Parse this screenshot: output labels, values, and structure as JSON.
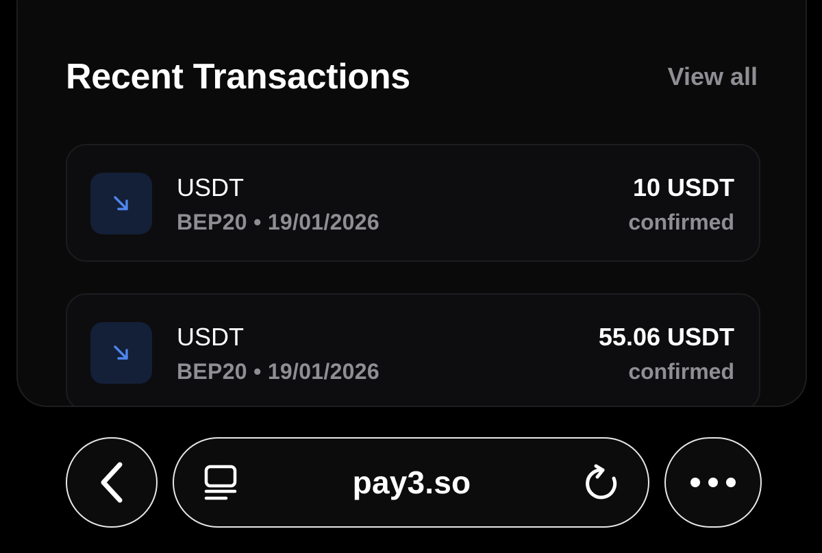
{
  "card": {
    "title": "Recent Transactions",
    "view_all": "View all"
  },
  "transactions": [
    {
      "token": "USDT",
      "network": "BEP20",
      "separator": "•",
      "date": "19/01/2026",
      "amount": "10 USDT",
      "status": "confirmed",
      "icon": "arrow-down-right-icon"
    },
    {
      "token": "USDT",
      "network": "BEP20",
      "separator": "•",
      "date": "19/01/2026",
      "amount": "55.06 USDT",
      "status": "confirmed",
      "icon": "arrow-down-right-icon"
    }
  ],
  "browser": {
    "url": "pay3.so",
    "icons": [
      "chevron-left-icon",
      "page-menu-icon",
      "reload-icon",
      "more-icon"
    ]
  },
  "colors": {
    "background": "#000000",
    "card": "#0a0a0b",
    "muted_text": "#8e8e93",
    "icon_tile": "#142038",
    "icon_accent": "#4f86ee"
  }
}
